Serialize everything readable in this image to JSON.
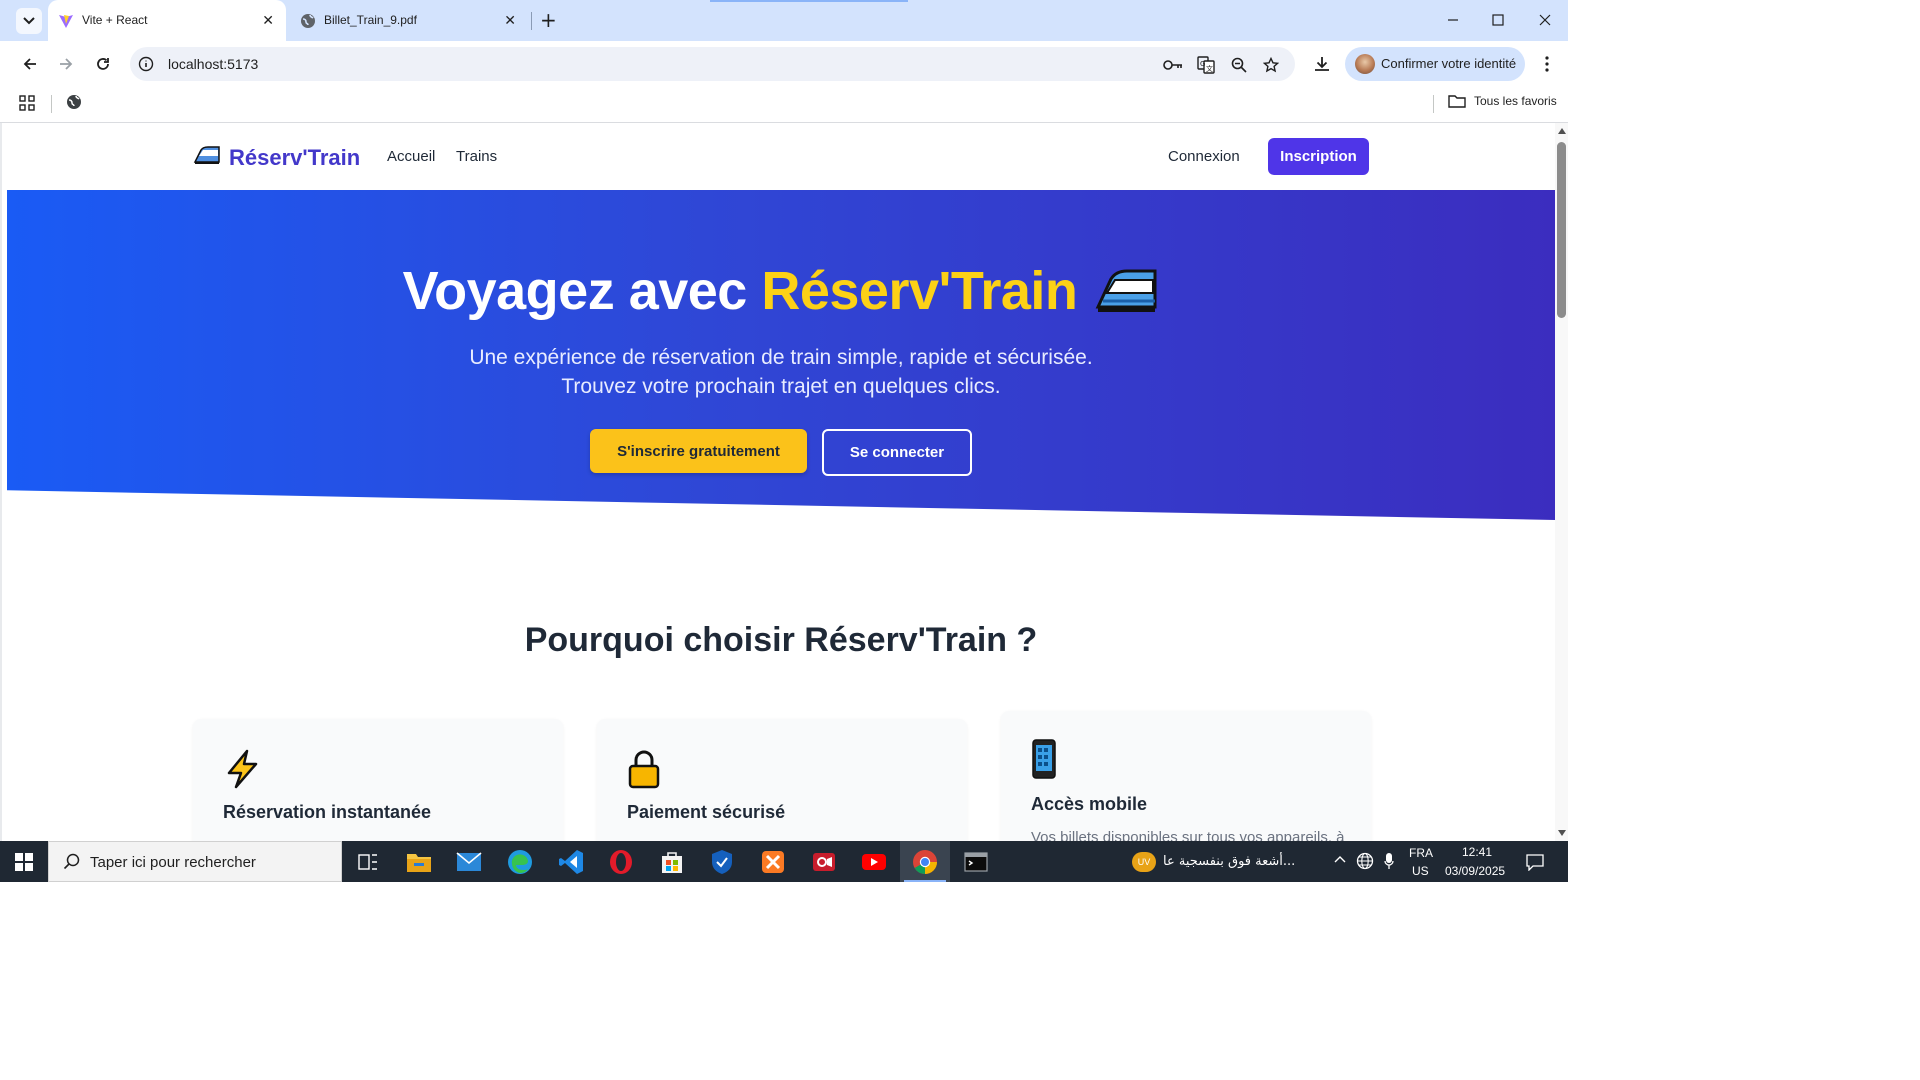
{
  "browser": {
    "tabs": [
      {
        "title": "Vite + React",
        "icon": "vite-icon",
        "active": true
      },
      {
        "title": "Billet_Train_9.pdf",
        "icon": "globe-icon",
        "active": false
      }
    ],
    "url": "localhost:5173",
    "profile_label": "Confirmer votre identité",
    "bookmarks_all": "Tous les favoris"
  },
  "site": {
    "brand_emoji": "🚄",
    "brand": "Réserv'Train",
    "nav": {
      "home": "Accueil",
      "trains": "Trains",
      "login": "Connexion",
      "signup": "Inscription"
    },
    "hero": {
      "title_prefix": "Voyagez avec ",
      "title_accent": "Réserv'Train",
      "subtitle_line1": "Une expérience de réservation de train simple, rapide et sécurisée.",
      "subtitle_line2": "Trouvez votre prochain trajet en quelques clics.",
      "cta_primary": "S'inscrire gratuitement",
      "cta_secondary": "Se connecter"
    },
    "features_title": "Pourquoi choisir Réserv'Train ?",
    "features": [
      {
        "icon": "lightning-icon",
        "title": "Réservation instantanée",
        "text": ""
      },
      {
        "icon": "lock-icon",
        "title": "Paiement sécurisé",
        "text": ""
      },
      {
        "icon": "mobile-phone-icon",
        "title": "Accès mobile",
        "text": "Vos billets disponibles sur tous vos appareils, à"
      }
    ]
  },
  "taskbar": {
    "search_placeholder": "Taper ici pour rechercher",
    "news_text": "أشعة فوق بنفسجية عا...",
    "weather_badge": "UV",
    "lang_top": "FRA",
    "lang_bottom": "US",
    "time": "12:41",
    "date": "03/09/2025"
  },
  "colors": {
    "brand": "#4338ca",
    "accent": "#fcd116",
    "signup_bg": "#4f35e8",
    "hero_from": "#1a5bf5",
    "hero_to": "#3b2dbf"
  }
}
